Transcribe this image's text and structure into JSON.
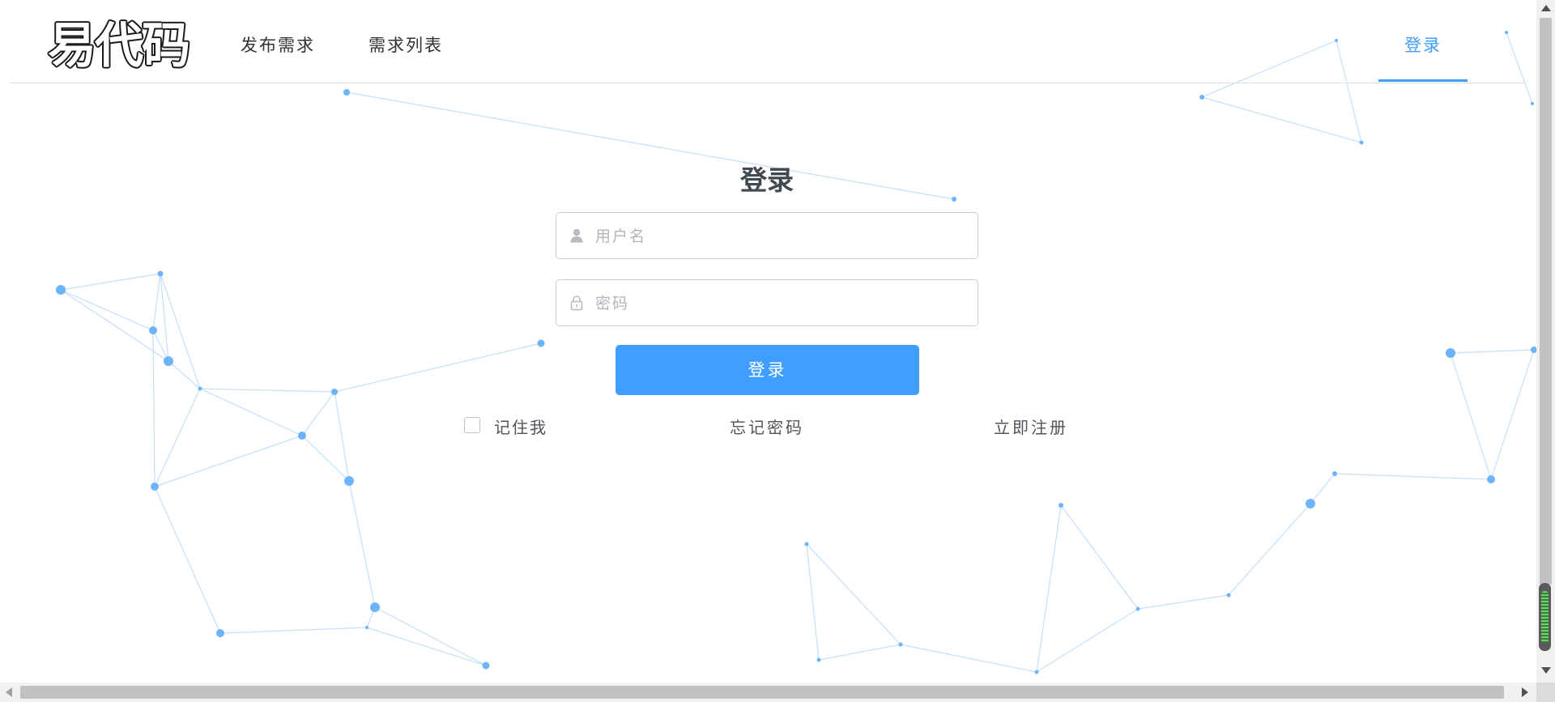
{
  "header": {
    "logo_text": "易代码",
    "nav": {
      "publish": "发布需求",
      "list": "需求列表",
      "login": "登录"
    }
  },
  "login_form": {
    "title": "登录",
    "username_placeholder": "用户名",
    "password_placeholder": "密码",
    "submit_label": "登录",
    "remember_label": "记住我",
    "remember_checked": false,
    "forgot_label": "忘记密码",
    "register_label": "立即注册"
  },
  "icons": {
    "username": "user-icon",
    "password": "lock-icon"
  },
  "colors": {
    "accent": "#409eff",
    "particles": "#6db3f8",
    "text": "#303133"
  }
}
